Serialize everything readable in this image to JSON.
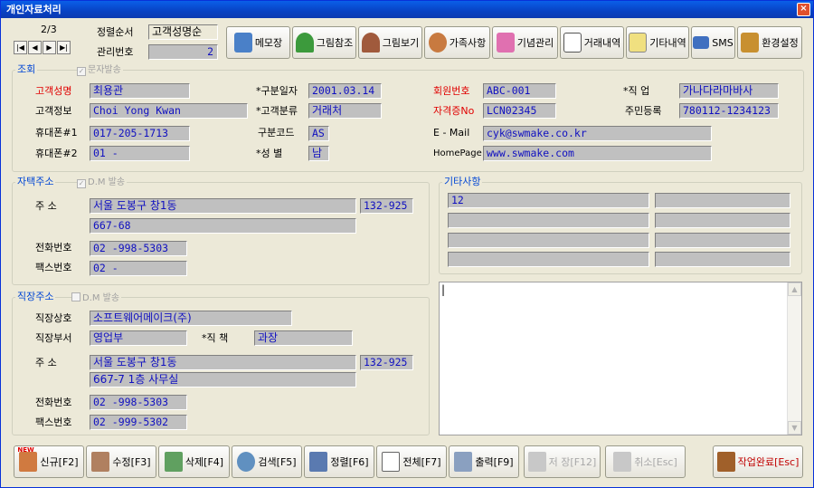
{
  "window": {
    "title": "개인자료처리",
    "close": "×"
  },
  "nav": {
    "record": "2/3",
    "sort_label": "정렬순서",
    "sort_value": "고객성명순",
    "mgmt_label": "관리번호",
    "mgmt_value": "2",
    "first": "|◀",
    "prev": "◀",
    "next": "▶",
    "last": "▶|"
  },
  "toolbar": [
    "메모장",
    "그림참조",
    "그림보기",
    "가족사항",
    "기념관리",
    "거래내역",
    "기타내역",
    "SMS",
    "환경설정"
  ],
  "lookup": {
    "title": "조회",
    "sms_check": "문자발송",
    "name_label": "고객성명",
    "name": "최용관",
    "info_label": "고객정보",
    "info": "Choi Yong Kwan",
    "phone1_label": "휴대폰#1",
    "phone1": "017-205-1713",
    "phone2_label": "휴대폰#2",
    "phone2": "01 -",
    "date_label": "*구분일자",
    "date": "2001.03.14",
    "class_label": "*고객분류",
    "class": "거래처",
    "code_label": "구분코드",
    "code": "AS",
    "gender_label": "*성   별",
    "gender": "남",
    "member_label": "회원번호",
    "member": "ABC-001",
    "cert_label": "자격증No",
    "cert": "LCN02345",
    "email_label": "E - Mail",
    "email": "cyk@swmake.co.kr",
    "home_label": "HomePage",
    "home": "www.swmake.com",
    "job_label": "*직   업",
    "job": "가나다라마바사",
    "resid_label": "주민등록",
    "resid": "780112-1234123"
  },
  "home": {
    "title": "자택주소",
    "dm_check": "D.M 발송",
    "addr_label": "주    소",
    "addr1": "서울 도봉구 창1동",
    "zip": "132-925",
    "addr2": "667-68",
    "tel_label": "전화번호",
    "tel": "02  -998-5303",
    "fax_label": "팩스번호",
    "fax": "02  -"
  },
  "etc": {
    "title": "기타사항",
    "rows": [
      "12",
      "",
      "",
      "",
      "",
      "",
      "",
      ""
    ]
  },
  "work": {
    "title": "직장주소",
    "dm_check": "D.M 발송",
    "company_label": "직장상호",
    "company": "소프트웨어메이크(주)",
    "dept_label": "직장부서",
    "dept": "영업부",
    "pos_label": "*직   책",
    "pos": "과장",
    "addr_label": "주    소",
    "addr1": "서울 도봉구 창1동",
    "zip": "132-925",
    "addr2": "667-7 1층 사무실",
    "tel_label": "전화번호",
    "tel": "02  -998-5303",
    "fax_label": "팩스번호",
    "fax": "02  -999-5302"
  },
  "memo": {
    "value": "|"
  },
  "buttons": {
    "new": "신규[F2]",
    "new_badge": "NEW",
    "edit": "수정[F3]",
    "delete": "삭제[F4]",
    "search": "검색[F5]",
    "sort": "정렬[F6]",
    "all": "전체[F7]",
    "print": "출력[F9]",
    "save": "저 장[F12]",
    "cancel": "취소[Esc]",
    "done": "작업완료[Esc]"
  },
  "colors": {
    "title_bar": "#0842c4",
    "field_bg": "#c0c0c0",
    "field_text": "#1010c0",
    "required_label": "#e00000",
    "group_title": "#0046d5"
  }
}
